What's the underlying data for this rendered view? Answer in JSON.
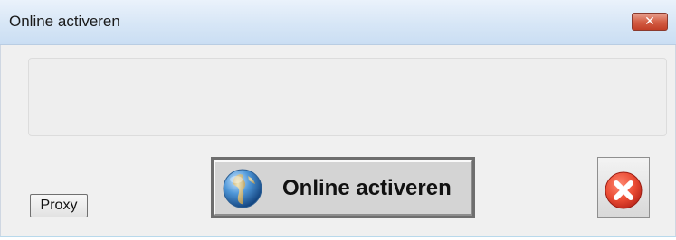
{
  "window": {
    "title": "Online activeren",
    "close_glyph": "✕"
  },
  "message_panel": {
    "text": ""
  },
  "buttons": {
    "proxy_label": "Proxy",
    "activate_label": "Online activeren",
    "activate_icon": "globe-icon",
    "cancel_icon": "error-x-icon"
  },
  "colors": {
    "titlebar": "#d7e6f6",
    "client_bg": "#f0f0f0",
    "close_button": "#d45f46",
    "cancel_red": "#e8412c"
  }
}
